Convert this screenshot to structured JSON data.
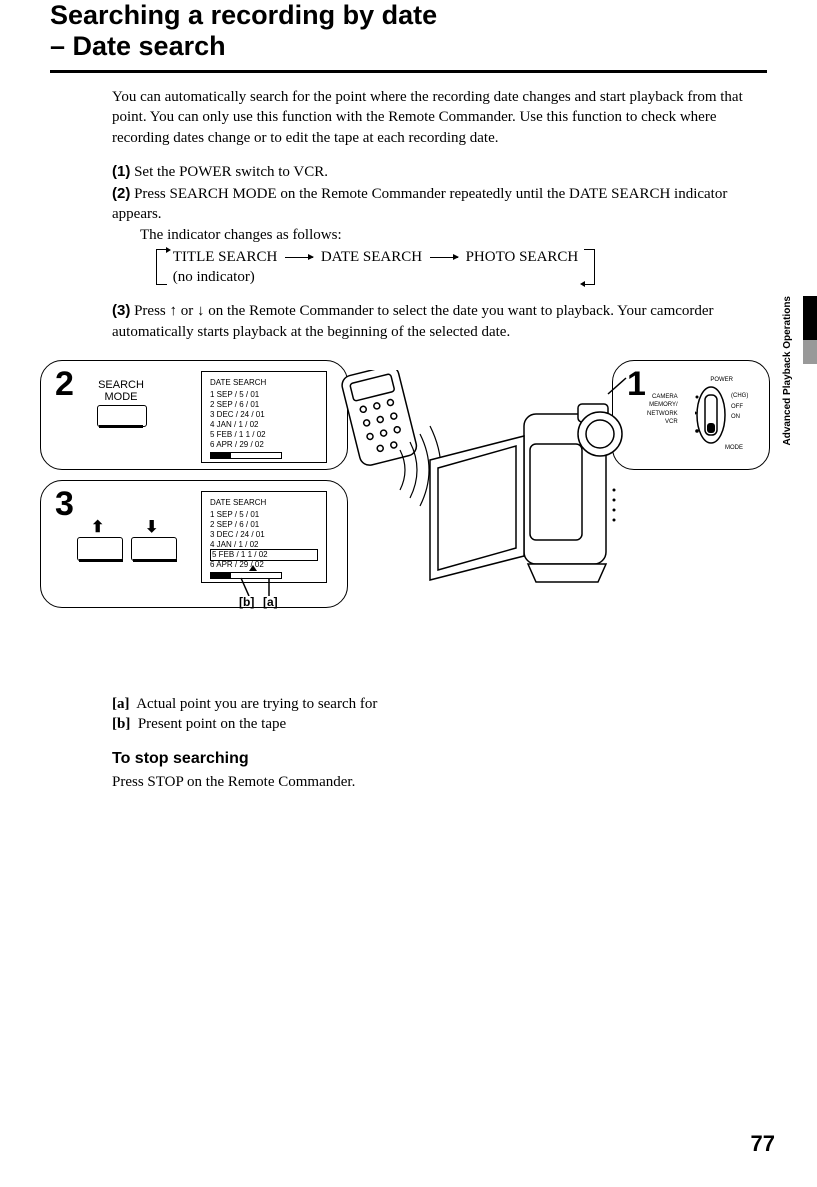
{
  "title_line1": "Searching a recording by date",
  "title_line2": "– Date search",
  "intro": "You can automatically search for the point where the recording date changes and start playback from that point. You can only use this function with the Remote Commander. Use this function to check where recording dates change or to edit the tape at each recording date.",
  "steps": {
    "s1_bold": "(1)",
    "s1_text": "Set the POWER switch to VCR.",
    "s2_bold": "(2)",
    "s2_text": "Press SEARCH MODE on the Remote Commander repeatedly until the DATE SEARCH indicator appears.",
    "s2_sub": "The indicator changes as follows:",
    "seq1": "TITLE SEARCH",
    "seq2": "DATE SEARCH",
    "seq3": "PHOTO SEARCH",
    "seq4": "(no indicator)",
    "s3_bold": "(3)",
    "s3a": "Press ",
    "s3b": " or ",
    "s3c": " on the Remote Commander to select the date you want to playback. Your camcorder automatically starts playback at the beginning of the selected date."
  },
  "figure": {
    "panel2_num": "2",
    "panel2_label": "SEARCH\nMODE",
    "panel3_num": "3",
    "panel1_num": "1",
    "lcd_title": "DATE  SEARCH",
    "dates": [
      "1   SEP /    5 / 01",
      "2   SEP /    6 / 01",
      "3   DEC / 24 / 01",
      "4   JAN   /    1 / 02",
      "5   FEB /  1 1 / 02",
      "6   APR /  29 / 02"
    ],
    "annot_a": "[a]",
    "annot_b": "[b]",
    "power_label": "POWER",
    "power_items": {
      "camera": "CAMERA",
      "memnet": "MEMORY/\nNETWORK",
      "vcr": "VCR",
      "chg": "(CHG)",
      "off": "OFF",
      "on": "ON",
      "mode": "MODE"
    }
  },
  "notes": {
    "a_bold": "[a]",
    "a_text": "Actual point you are trying to search for",
    "b_bold": "[b]",
    "b_text": "Present point on the tape"
  },
  "stop_heading": "To stop searching",
  "stop_text": "Press STOP on the Remote Commander.",
  "section_label": "Advanced Playback Operations",
  "page_number": "77"
}
